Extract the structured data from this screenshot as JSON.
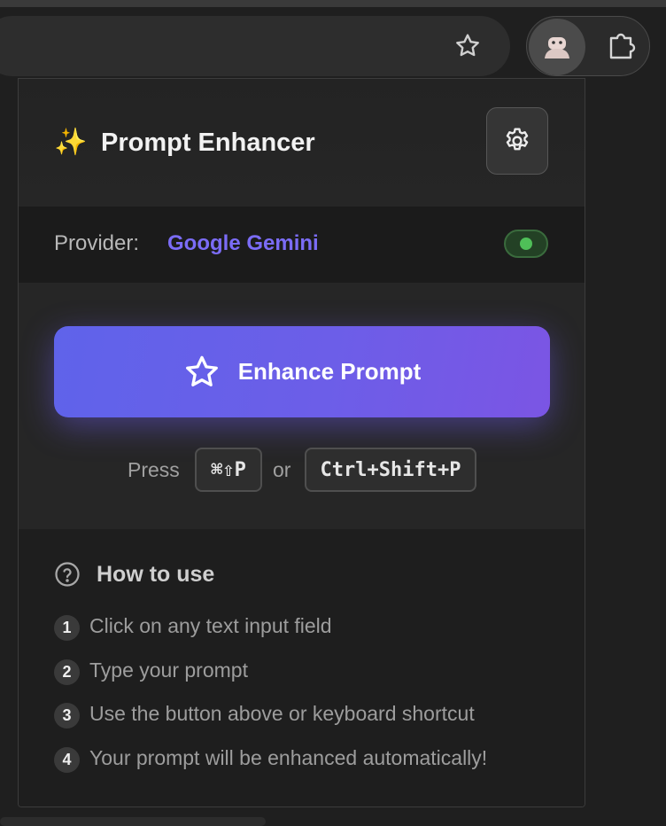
{
  "popup": {
    "title": "Prompt Enhancer",
    "sparkle_icon": "✨",
    "settings_icon": "gear-icon"
  },
  "provider": {
    "label": "Provider:",
    "name": "Google Gemini",
    "enabled": true
  },
  "enhance": {
    "button_label": "Enhance Prompt",
    "press_label": "Press",
    "mac_shortcut": "⌘⇧P",
    "or_label": "or",
    "win_shortcut": "Ctrl+Shift+P"
  },
  "howto": {
    "title": "How to use",
    "steps": [
      {
        "num": "1",
        "text": "Click on any text input field"
      },
      {
        "num": "2",
        "text": "Type your prompt"
      },
      {
        "num": "3",
        "text": "Use the button above or keyboard shortcut"
      },
      {
        "num": "4",
        "text": "Your prompt will be enhanced automatically!"
      }
    ]
  },
  "colors": {
    "accent": "#6c5ee8",
    "provider_text": "#7b6cf6",
    "toggle_on": "#4fbf58"
  }
}
